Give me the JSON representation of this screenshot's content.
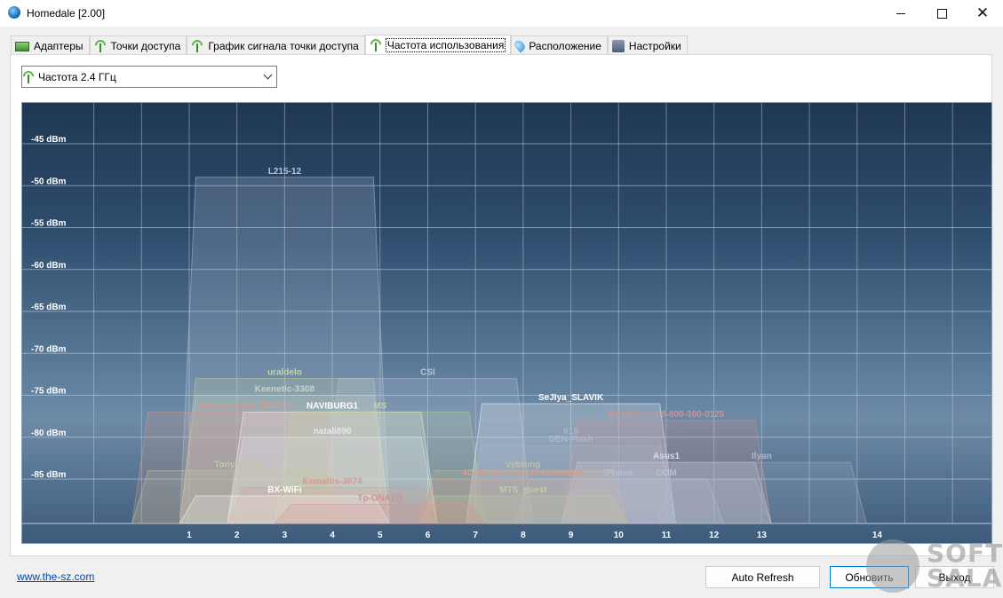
{
  "window": {
    "title": "Homedale [2.00]"
  },
  "tabs": [
    {
      "label": "Адаптеры",
      "icon": "network-adapter-icon",
      "active": false
    },
    {
      "label": "Точки доступа",
      "icon": "wifi-antenna-icon",
      "active": false
    },
    {
      "label": "График сигнала точки доступа",
      "icon": "wifi-antenna-icon",
      "active": false
    },
    {
      "label": "Частота использования",
      "icon": "wifi-antenna-icon",
      "active": true
    },
    {
      "label": "Расположение",
      "icon": "map-pin-icon",
      "active": false
    },
    {
      "label": "Настройки",
      "icon": "settings-icon",
      "active": false
    }
  ],
  "band_select": {
    "value": "Частота 2.4 ГГц"
  },
  "chart_data": {
    "type": "area",
    "title": "",
    "xlabel": "",
    "ylabel": "",
    "x_ticks": [
      "1",
      "2",
      "3",
      "4",
      "5",
      "6",
      "7",
      "8",
      "9",
      "10",
      "11",
      "12",
      "13",
      "14"
    ],
    "y_ticks": [
      "-45 dBm",
      "-50 dBm",
      "-55 dBm",
      "-60 dBm",
      "-65 dBm",
      "-70 dBm",
      "-75 dBm",
      "-80 dBm",
      "-85 dBm"
    ],
    "xlim": [
      -0.5,
      16.5
    ],
    "ylim": [
      -90,
      -40
    ],
    "grid": true,
    "networks": [
      {
        "name": "L215-12",
        "channel": 3,
        "dbm": -49,
        "color": "#b9c6da"
      },
      {
        "name": "uraldelo",
        "channel": 3,
        "dbm": -73,
        "color": "#c6d69a"
      },
      {
        "name": "CSI",
        "channel": 6,
        "dbm": -73,
        "color": "#b9c6da"
      },
      {
        "name": "Keenetic-3308",
        "channel": 3,
        "dbm": -75,
        "color": "#c9d2cc"
      },
      {
        "name": "SeJIya_SLAVIK",
        "channel": 9,
        "dbm": -76,
        "color": "#ffffff"
      },
      {
        "name": "Ekaterinburg_DO",
        "channel": 2,
        "dbm": -77,
        "color": "#d89a8e"
      },
      {
        "name": "Kirh",
        "channel": 3,
        "dbm": -77,
        "color": "#c89aa6"
      },
      {
        "name": "NAVIBURG1",
        "channel": 4,
        "dbm": -77,
        "color": "#ffffff"
      },
      {
        "name": "MS",
        "channel": 5,
        "dbm": -77,
        "color": "#c6d69a"
      },
      {
        "name": "Rostelecom 8-800-300-0125",
        "channel": 11,
        "dbm": -78,
        "color": "#d98f8f"
      },
      {
        "name": "natali890",
        "channel": 4,
        "dbm": -80,
        "color": "#e8e8f0"
      },
      {
        "name": "615",
        "channel": 9,
        "dbm": -80,
        "color": "#a9b8c8"
      },
      {
        "name": "DEN-Flash",
        "channel": 9,
        "dbm": -81,
        "color": "#a9b8c8"
      },
      {
        "name": "Asus1",
        "channel": 11,
        "dbm": -83,
        "color": "#d8d8e0"
      },
      {
        "name": "Ilyan",
        "channel": 13,
        "dbm": -83,
        "color": "#a9b8c8"
      },
      {
        "name": "vybiring",
        "channel": 8,
        "dbm": -84,
        "color": "#c6c19a"
      },
      {
        "name": "Tony Clerk",
        "channel": 2,
        "dbm": -84,
        "color": "#c2cba0"
      },
      {
        "name": "4C-9E-84-25-30-40-Homedale",
        "channel": 8,
        "dbm": -85,
        "color": "#d89a8e"
      },
      {
        "name": "iPhone",
        "channel": 10,
        "dbm": -85,
        "color": "#b7bfd0"
      },
      {
        "name": "DOM",
        "channel": 11,
        "dbm": -85,
        "color": "#b7bfd0"
      },
      {
        "name": "Kamaltis-3874",
        "channel": 4,
        "dbm": -86,
        "color": "#d89a8e"
      },
      {
        "name": "BX-WiFi",
        "channel": 3,
        "dbm": -87,
        "color": "#ffffff"
      },
      {
        "name": "MTS_guest",
        "channel": 8,
        "dbm": -87,
        "color": "#c2cba0"
      },
      {
        "name": "Tp-GNAZD",
        "channel": 5,
        "dbm": -88,
        "color": "#d98f8f"
      }
    ]
  },
  "footer": {
    "link_text": "www.the-sz.com",
    "auto_refresh_label": "Auto Refresh",
    "refresh_label": "Обновить",
    "exit_label": "Выход"
  },
  "watermark": {
    "line1": "SOFT",
    "line2": "SALAD"
  }
}
